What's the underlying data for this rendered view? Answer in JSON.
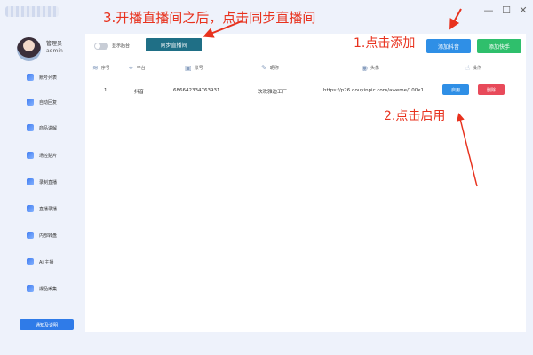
{
  "window": {
    "minimize": "—",
    "maximize": "☐",
    "close": "✕"
  },
  "sidebar": {
    "user_name": "管理员",
    "user_role": "admin",
    "items": [
      {
        "label": "账号列表"
      },
      {
        "label": "自动回复"
      },
      {
        "label": "商品讲解"
      },
      {
        "label": "场控贴片"
      },
      {
        "label": "录制直播"
      },
      {
        "label": "直播录播"
      },
      {
        "label": "内部转盘"
      },
      {
        "label": "Ai 主播"
      },
      {
        "label": "爆品采集"
      }
    ],
    "notice_button": "通知及说明"
  },
  "toolbar": {
    "toggle_label": "显示后台",
    "sync_button": "同步直播间",
    "add_douyin": "添加抖音",
    "add_kuaishou": "添加快手"
  },
  "table": {
    "columns": [
      "序号",
      "平台",
      "账号",
      "昵称",
      "头像",
      "操作"
    ],
    "rows": [
      {
        "index": "1",
        "platform": "抖音",
        "account": "686642334763931",
        "nickname": "欢欢雅迪工厂",
        "avatar": "https://p26.douyinpic.com/aweme/100x1",
        "enable_label": "启用",
        "delete_label": "删除"
      }
    ]
  },
  "annotations": {
    "step1": "1.点击添加",
    "step2": "2.点击启用",
    "step3": "3.开播直播间之后，点击同步直播间"
  },
  "colors": {
    "annotation": "#e8321e",
    "sync_button": "#1f6f86",
    "primary": "#2f8fe6",
    "success": "#2fbf6c",
    "danger": "#e84a5a"
  }
}
